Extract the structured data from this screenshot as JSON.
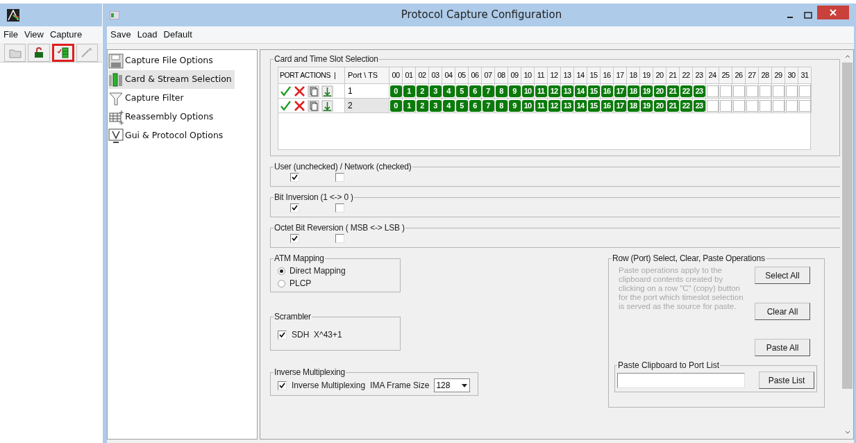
{
  "background_window": {
    "menu": [
      "File",
      "View",
      "Capture"
    ],
    "toolbar": [
      {
        "kind": "folder",
        "highlighted": false
      },
      {
        "kind": "unlock",
        "highlighted": false
      },
      {
        "kind": "card",
        "highlighted": true
      },
      {
        "kind": "wand",
        "highlighted": false
      }
    ]
  },
  "window": {
    "title": "Protocol Capture Configuration"
  },
  "menu": [
    "Save",
    "Load",
    "Default"
  ],
  "nav": [
    {
      "label": "Capture File Options",
      "kind": "floppy",
      "selected": false
    },
    {
      "label": "Card & Stream Selection",
      "kind": "card",
      "selected": true
    },
    {
      "label": "Capture Filter",
      "kind": "funnel",
      "selected": false
    },
    {
      "label": "Reassembly Options",
      "kind": "grid",
      "selected": false
    },
    {
      "label": "Gui & Protocol Options",
      "kind": "monitor",
      "selected": false
    }
  ],
  "card_selection": {
    "title": "Card and Time Slot Selection",
    "actions_header": "PORT ACTIONS  |",
    "port_header": "Port \\ TS",
    "columns": [
      "00",
      "01",
      "02",
      "03",
      "04",
      "05",
      "06",
      "07",
      "08",
      "09",
      "10",
      "11",
      "12",
      "13",
      "14",
      "15",
      "16",
      "17",
      "18",
      "19",
      "20",
      "21",
      "22",
      "23",
      "24",
      "25",
      "26",
      "27",
      "28",
      "29",
      "30",
      "31"
    ],
    "rows": [
      {
        "port": "1",
        "selected": false,
        "slots": [
          {
            "label": "0",
            "selected": true
          },
          {
            "label": "1",
            "selected": true
          },
          {
            "label": "2",
            "selected": true
          },
          {
            "label": "3",
            "selected": true
          },
          {
            "label": "4",
            "selected": true
          },
          {
            "label": "5",
            "selected": true
          },
          {
            "label": "6",
            "selected": true
          },
          {
            "label": "7",
            "selected": true
          },
          {
            "label": "8",
            "selected": true
          },
          {
            "label": "9",
            "selected": true
          },
          {
            "label": "10",
            "selected": true
          },
          {
            "label": "11",
            "selected": true
          },
          {
            "label": "12",
            "selected": true
          },
          {
            "label": "13",
            "selected": true
          },
          {
            "label": "14",
            "selected": true
          },
          {
            "label": "15",
            "selected": true
          },
          {
            "label": "16",
            "selected": true
          },
          {
            "label": "17",
            "selected": true
          },
          {
            "label": "18",
            "selected": true
          },
          {
            "label": "19",
            "selected": true
          },
          {
            "label": "20",
            "selected": true
          },
          {
            "label": "21",
            "selected": true
          },
          {
            "label": "22",
            "selected": true
          },
          {
            "label": "23",
            "selected": true
          },
          {
            "selected": false
          },
          {
            "selected": false
          },
          {
            "selected": false
          },
          {
            "selected": false
          },
          {
            "selected": false
          },
          {
            "selected": false
          },
          {
            "selected": false
          },
          {
            "selected": false
          }
        ]
      },
      {
        "port": "2",
        "selected": true,
        "slots": [
          {
            "label": "0",
            "selected": true
          },
          {
            "label": "1",
            "selected": true
          },
          {
            "label": "2",
            "selected": true
          },
          {
            "label": "3",
            "selected": true
          },
          {
            "label": "4",
            "selected": true
          },
          {
            "label": "5",
            "selected": true
          },
          {
            "label": "6",
            "selected": true
          },
          {
            "label": "7",
            "selected": true
          },
          {
            "label": "8",
            "selected": true
          },
          {
            "label": "9",
            "selected": true
          },
          {
            "label": "10",
            "selected": true
          },
          {
            "label": "11",
            "selected": true
          },
          {
            "label": "12",
            "selected": true
          },
          {
            "label": "13",
            "selected": true
          },
          {
            "label": "14",
            "selected": true
          },
          {
            "label": "15",
            "selected": true
          },
          {
            "label": "16",
            "selected": true
          },
          {
            "label": "17",
            "selected": true
          },
          {
            "label": "18",
            "selected": true
          },
          {
            "label": "19",
            "selected": true
          },
          {
            "label": "20",
            "selected": true
          },
          {
            "label": "21",
            "selected": true
          },
          {
            "label": "22",
            "selected": true
          },
          {
            "label": "23",
            "selected": true
          },
          {
            "selected": false
          },
          {
            "selected": false
          },
          {
            "selected": false
          },
          {
            "selected": false
          },
          {
            "selected": false
          },
          {
            "selected": false
          },
          {
            "selected": false
          },
          {
            "selected": false
          }
        ]
      }
    ]
  },
  "checkbox_groups": [
    {
      "title": "User (unchecked) / Network (checked)",
      "boxes": [
        {
          "checked": true
        },
        {
          "checked": false
        }
      ]
    },
    {
      "title": "Bit Inversion (1 <-> 0 )",
      "boxes": [
        {
          "checked": true
        },
        {
          "checked": false
        }
      ]
    },
    {
      "title": "Octet Bit Reversion ( MSB <-> LSB )",
      "boxes": [
        {
          "checked": true
        },
        {
          "checked": false
        }
      ]
    }
  ],
  "atm_mapping": {
    "title": "ATM  Mapping",
    "options": [
      {
        "label": "Direct Mapping",
        "selected": true
      },
      {
        "label": "PLCP",
        "selected": false
      }
    ]
  },
  "scrambler": {
    "title": "Scrambler",
    "checkbox": {
      "label": "SDH  X^43+1",
      "checked": true
    }
  },
  "inverse_multiplexing": {
    "title": "Inverse Multiplexing",
    "checkbox": {
      "label": "Inverse Multiplexing",
      "checked": true
    },
    "frame_size_label": "IMA Frame Size",
    "frame_size": "128"
  },
  "row_operations": {
    "title": "Row (Port) Select, Clear, Paste Operations",
    "note": "Paste operations apply to the clipboard contents created by clicking on a row \"C\" (copy) button for the port which timeslot selection is served as the source for paste.",
    "buttons": [
      "Select All",
      "Clear All",
      "Paste All"
    ],
    "paste_list": {
      "title": "Paste Clipboard to Port List",
      "button": "Paste List"
    }
  }
}
